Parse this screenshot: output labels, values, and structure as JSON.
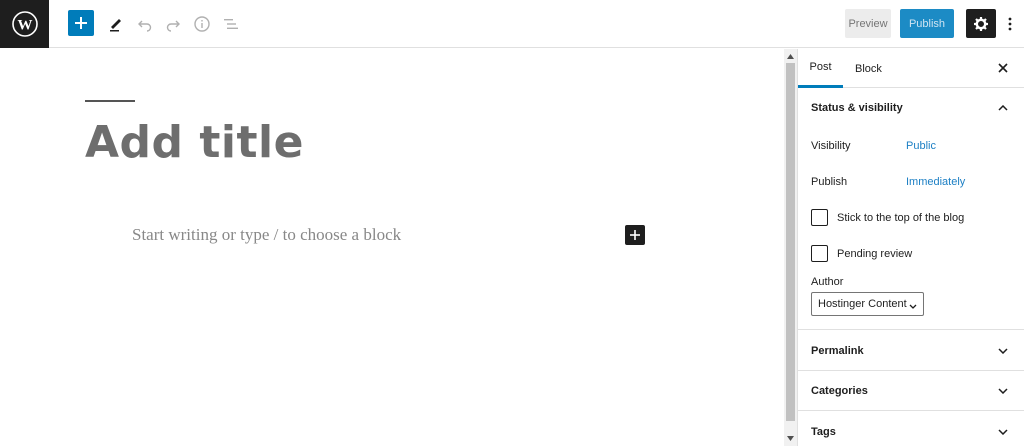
{
  "toolbar": {
    "preview_label": "Preview",
    "publish_label": "Publish"
  },
  "icons": {
    "logo": "wordpress-logo",
    "add": "plus-icon",
    "tools": "pencil-icon",
    "undo": "undo-icon",
    "redo": "redo-icon",
    "info": "info-icon",
    "outline": "list-view-icon",
    "settings": "gear-icon",
    "more": "more-vertical-icon"
  },
  "colors": {
    "accent": "#007cba",
    "publish_bg": "#1c8bc5",
    "dark": "#1e1e1e"
  },
  "editor": {
    "title_placeholder": "Add title",
    "body_placeholder": "Start writing or type / to choose a block"
  },
  "sidebar": {
    "tabs": [
      {
        "label": "Post",
        "active": true
      },
      {
        "label": "Block",
        "active": false
      }
    ],
    "status": {
      "title": "Status & visibility",
      "visibility_label": "Visibility",
      "visibility_value": "Public",
      "publish_label": "Publish",
      "publish_value": "Immediately",
      "sticky_label": "Stick to the top of the blog",
      "pending_label": "Pending review",
      "author_label": "Author",
      "author_value": "Hostinger Content"
    },
    "panels": [
      {
        "title": "Permalink"
      },
      {
        "title": "Categories"
      },
      {
        "title": "Tags"
      }
    ]
  }
}
